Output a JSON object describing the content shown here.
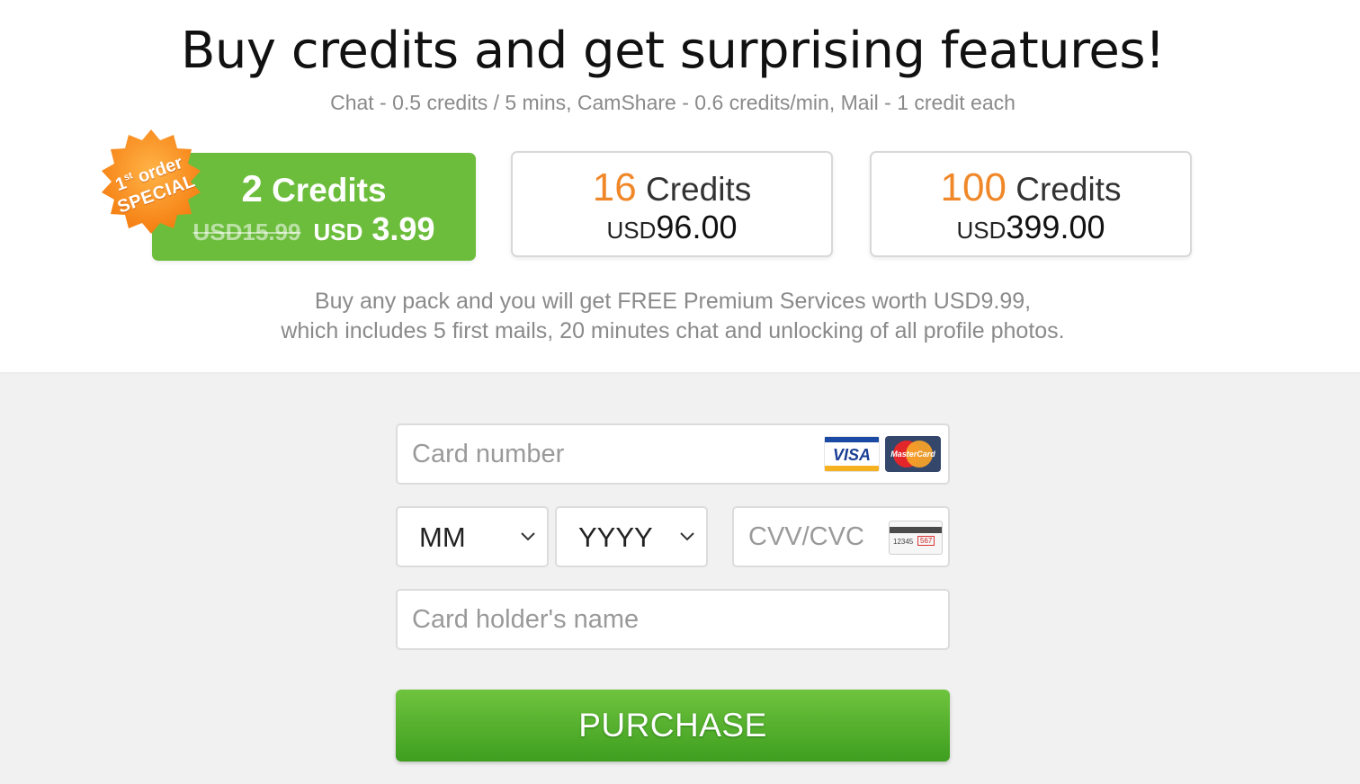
{
  "header": {
    "title": "Buy credits and get surprising features!",
    "rates": "Chat - 0.5 credits / 5 mins, CamShare - 0.6 credits/min, Mail - 1 credit each"
  },
  "badge": {
    "line1_prefix": "1",
    "line1_sup": "st",
    "line1_suffix": " order",
    "line2": "SPECIAL",
    "color": "#f7931e"
  },
  "packs": [
    {
      "count": "2",
      "unit": "Credits",
      "old_price": "USD15.99",
      "currency": "USD",
      "price": "3.99",
      "selected": true
    },
    {
      "count": "16",
      "unit": "Credits",
      "currency": "USD",
      "price": "96.00",
      "selected": false
    },
    {
      "count": "100",
      "unit": "Credits",
      "currency": "USD",
      "price": "399.00",
      "selected": false
    }
  ],
  "info": {
    "line1": "Buy any pack and you will get FREE Premium Services worth USD9.99,",
    "line2": "which includes 5 first mails, 20 minutes chat and unlocking of all profile photos."
  },
  "form": {
    "card_number_placeholder": "Card number",
    "month_value": "MM",
    "year_value": "YYYY",
    "cvv_placeholder": "CVV/CVC",
    "cvv_card_digits": "12345",
    "cvv_card_code": "567",
    "holder_placeholder": "Card holder's name",
    "purchase_label": "PURCHASE"
  },
  "logos": {
    "visa": "VISA",
    "mastercard": "MasterCard"
  },
  "colors": {
    "accent_green": "#6cbd3c",
    "accent_orange": "#f0882a",
    "button_green": "#4caf2a"
  }
}
